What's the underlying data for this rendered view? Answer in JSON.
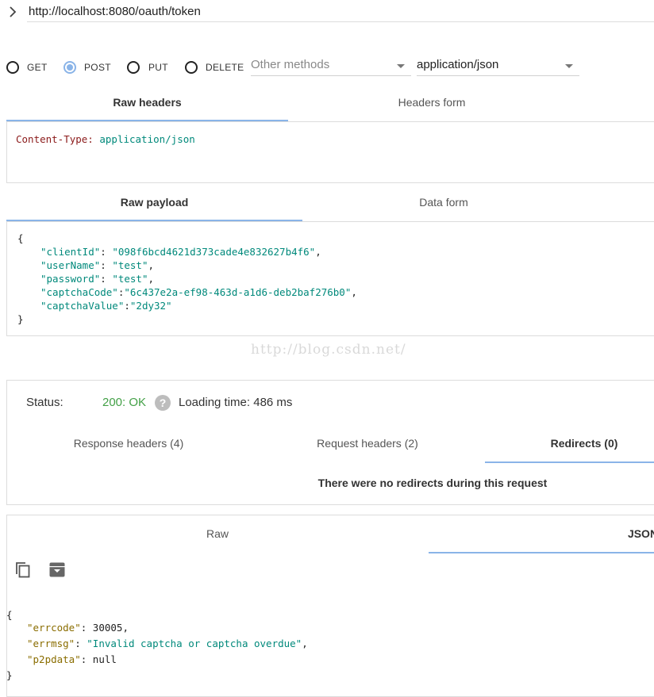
{
  "request": {
    "url": "http://localhost:8080/oauth/token",
    "methods": [
      {
        "label": "GET",
        "selected": false
      },
      {
        "label": "POST",
        "selected": true
      },
      {
        "label": "PUT",
        "selected": false
      },
      {
        "label": "DELETE",
        "selected": false
      }
    ],
    "other_methods": "Other methods",
    "content_type": "application/json"
  },
  "headers": {
    "tabs": [
      "Raw headers",
      "Headers form"
    ],
    "active_tab": "Raw headers",
    "raw": {
      "name": "Content-Type:",
      "value": "application/json"
    }
  },
  "payload": {
    "tabs": [
      "Raw payload",
      "Data form"
    ],
    "active_tab": "Raw payload",
    "open": "{",
    "close": "}",
    "lines": [
      {
        "key": "\"clientId\"",
        "sep": ": ",
        "value": "\"098f6bcd4621d373cade4e832627b4f6\"",
        "tail": ","
      },
      {
        "key": "\"userName\"",
        "sep": ": ",
        "value": "\"test\"",
        "tail": ","
      },
      {
        "key": "\"password\"",
        "sep": ": ",
        "value": "\"test\"",
        "tail": ","
      },
      {
        "key": "\"captchaCode\"",
        "sep": ":",
        "value": "\"6c437e2a-ef98-463d-a1d6-deb2baf276b0\"",
        "tail": ","
      },
      {
        "key": "\"captchaValue\"",
        "sep": ":",
        "value": "\"2dy32\"",
        "tail": ""
      }
    ]
  },
  "watermark": "http://blog.csdn.net/",
  "response_status": {
    "status_label": "Status:",
    "status_value": "200: OK",
    "help_icon": "?",
    "loading_time": "Loading time: 486 ms",
    "tabs": [
      "Response headers (4)",
      "Request headers (2)",
      "Redirects (0)"
    ],
    "active_tab": "Redirects (0)",
    "redirect_message": "There were no redirects during this request"
  },
  "response_body": {
    "tabs": [
      "Raw",
      "JSON"
    ],
    "active_tab": "JSON",
    "actions": [
      "copy-icon",
      "archive-icon"
    ],
    "open": "{",
    "close": "}",
    "lines": [
      {
        "key": "\"errcode\"",
        "sep": ": ",
        "value": "30005",
        "tail": ",",
        "type": "number"
      },
      {
        "key": "\"errmsg\"",
        "sep": ": ",
        "value": "\"Invalid captcha or captcha overdue\"",
        "tail": ",",
        "type": "string"
      },
      {
        "key": "\"p2pdata\"",
        "sep": ": ",
        "value": "null",
        "tail": "",
        "type": "null"
      }
    ]
  },
  "colors": {
    "accent": "#8ab4e8",
    "status_ok": "#43a047",
    "json_string": "#00897b",
    "header_name": "#8b1a1a",
    "json_key": "#8a6d00"
  }
}
